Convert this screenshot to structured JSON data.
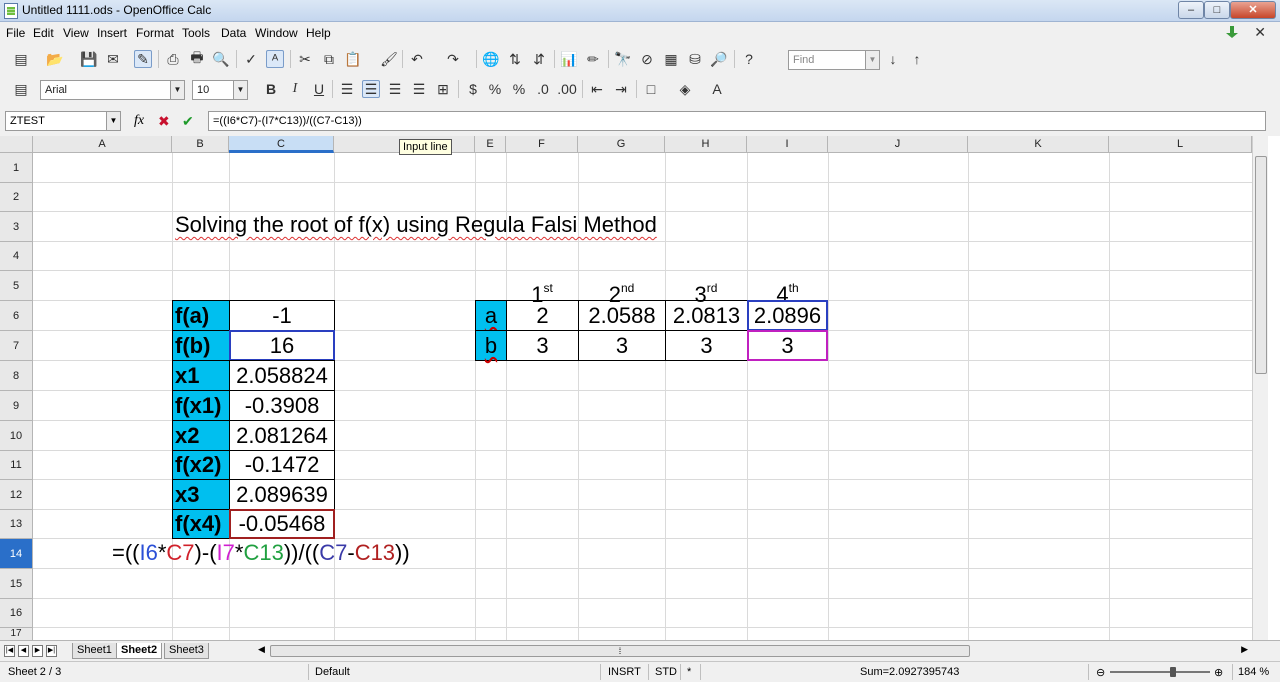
{
  "window": {
    "title": "Untitled 1111.ods - OpenOffice Calc",
    "min": "–",
    "max": "□",
    "close": "✕"
  },
  "menu": [
    "File",
    "Edit",
    "View",
    "Insert",
    "Format",
    "Tools",
    "Data",
    "Window",
    "Help"
  ],
  "toolbar": {
    "font_name": "Arial",
    "font_size": "10",
    "find_placeholder": "Find",
    "bold": "B",
    "italic": "I",
    "underline": "U"
  },
  "formula_bar": {
    "name_box": "ZTEST",
    "formula": "=((I6*C7)-(I7*C13))/((C7-C13))",
    "func_icon": "fx",
    "cancel_icon": "✖",
    "accept_icon": "✔"
  },
  "tooltip": "Input line",
  "columns": [
    "A",
    "B",
    "C",
    "D",
    "E",
    "F",
    "G",
    "H",
    "I",
    "J",
    "K",
    "L"
  ],
  "rows": [
    "1",
    "2",
    "3",
    "4",
    "5",
    "6",
    "7",
    "8",
    "9",
    "10",
    "11",
    "12",
    "13",
    "14",
    "15",
    "16",
    "17"
  ],
  "sheet": {
    "heading": "Solving the root of f(x) using Regula Falsi Method",
    "labels": [
      "f(a)",
      "f(b)",
      "x1",
      "f(x1)",
      "x2",
      "f(x2)",
      "x3",
      "f(x4)"
    ],
    "values": [
      "-1",
      "16",
      "2.058824",
      "-0.3908",
      "2.081264",
      "-0.1472",
      "2.089639",
      "-0.05468"
    ],
    "iter_headers": [
      {
        "num": "1",
        "suffix": "st"
      },
      {
        "num": "2",
        "suffix": "nd"
      },
      {
        "num": "3",
        "suffix": "rd"
      },
      {
        "num": "4",
        "suffix": "th"
      }
    ],
    "row_a_label": "a",
    "row_b_label": "b",
    "row_a": [
      "2",
      "2.0588",
      "2.0813",
      "2.0896"
    ],
    "row_b": [
      "3",
      "3",
      "3",
      "3"
    ],
    "formula_parts": [
      "=((",
      "I6",
      "*",
      "C7",
      ")-(",
      "I7",
      "*",
      "C13",
      "))/((",
      "C7",
      "-",
      "C13",
      "))"
    ]
  },
  "tabs": [
    "Sheet1",
    "Sheet2",
    "Sheet3"
  ],
  "status": {
    "sheet": "Sheet 2 / 3",
    "style": "Default",
    "mode": "INSRT",
    "selection": "STD",
    "modified": "*",
    "sum": "Sum=2.0927395743",
    "zoom": "184 %"
  }
}
